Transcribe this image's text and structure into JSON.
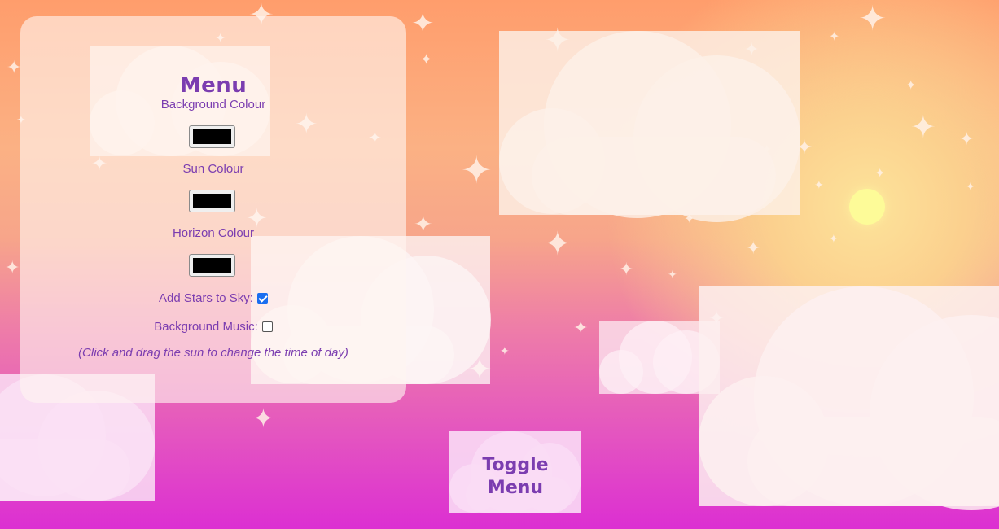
{
  "menu": {
    "title": "Menu",
    "background_colour_label": "Background Colour",
    "background_colour_value": "#000000",
    "sun_colour_label": "Sun Colour",
    "sun_colour_value": "#000000",
    "horizon_colour_label": "Horizon Colour",
    "horizon_colour_value": "#000000",
    "stars_label": "Add Stars to Sky:",
    "stars_checked": true,
    "music_label": "Background Music:",
    "music_checked": false,
    "hint": "(Click and drag the sun to change the time of day)"
  },
  "toggle": {
    "label_line1": "Toggle",
    "label_line2": "Menu"
  },
  "colors": {
    "accent_text": "#7b3db0",
    "sun": "#fdfb98",
    "cloud": "#fdf0e8",
    "checkbox_checked": "#1a6ef0"
  }
}
